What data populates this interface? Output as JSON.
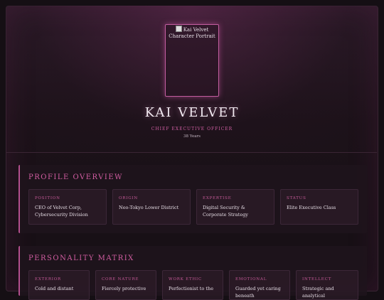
{
  "hero": {
    "portrait_alt": "Kai Velvet Character Portrait",
    "name": "KAI VELVET",
    "title": "CHIEF EXECUTIVE OFFICER",
    "age": "38 Years"
  },
  "profile": {
    "heading": "PROFILE OVERVIEW",
    "cards": [
      {
        "label": "POSITION",
        "value": "CEO of Velvet Corp, Cybersecurity Division"
      },
      {
        "label": "ORIGIN",
        "value": "Neo-Tokyo Lower District"
      },
      {
        "label": "EXPERTISE",
        "value": "Digital Security & Corporate Strategy"
      },
      {
        "label": "STATUS",
        "value": "Elite Executive Class"
      }
    ]
  },
  "personality": {
    "heading": "PERSONALITY MATRIX",
    "cards": [
      {
        "label": "EXTERIOR",
        "value": "Cold and distant"
      },
      {
        "label": "CORE NATURE",
        "value": "Fiercely protective"
      },
      {
        "label": "WORK ETHIC",
        "value": "Perfectionist to the"
      },
      {
        "label": "EMOTIONAL",
        "value": "Guarded yet caring beneath"
      },
      {
        "label": "INTELLECT",
        "value": "Strategic and analytical"
      }
    ]
  }
}
